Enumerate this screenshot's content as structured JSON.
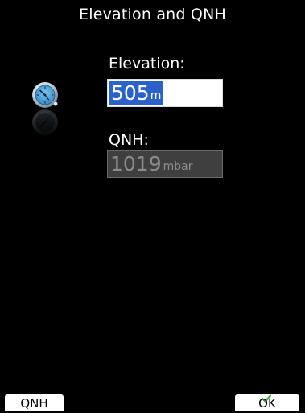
{
  "window": {
    "title": "Elevation and QNH"
  },
  "elevation": {
    "label": "Elevation:",
    "value": "505",
    "unit": "m"
  },
  "qnh": {
    "label": "QNH:",
    "value": "1019",
    "unit": "mbar"
  },
  "softkeys": {
    "left_label": "QNH",
    "right_label": "OK"
  },
  "icons": {
    "main": "clock-dial-icon",
    "ok_badge": "check-icon"
  },
  "colors": {
    "background": "#000000",
    "selection": "#2a62c9",
    "disabled_field": "#3f3f3f",
    "check": "#3aa83a"
  }
}
